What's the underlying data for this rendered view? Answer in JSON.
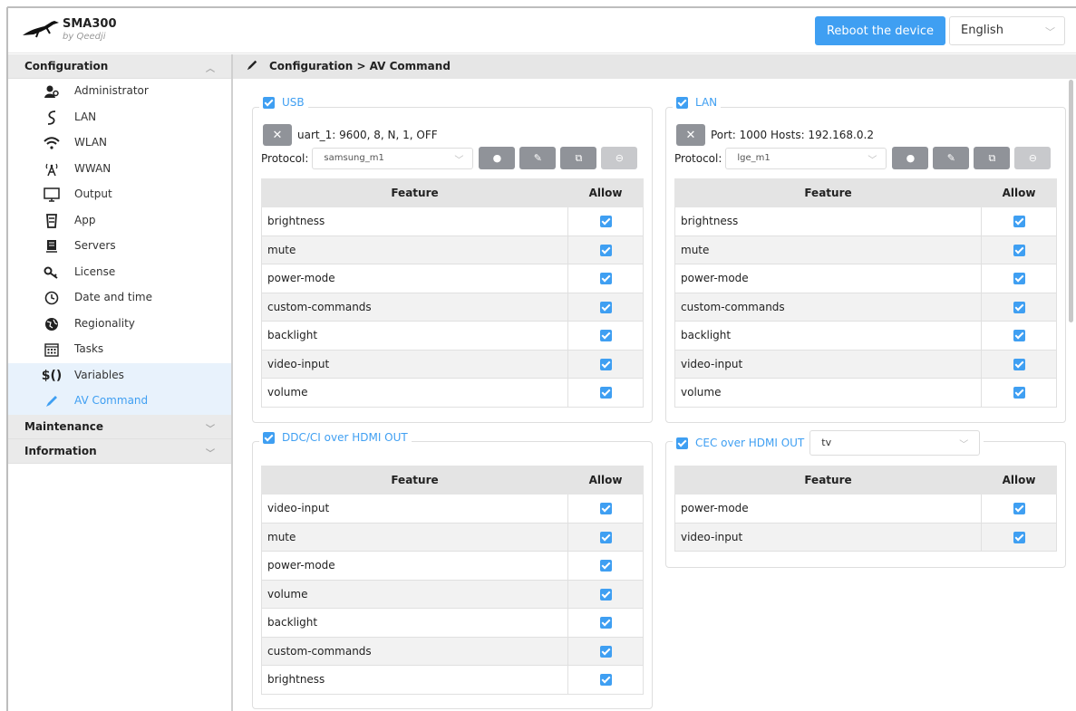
{
  "app": {
    "title": "SMA300",
    "subtitle": "by Qeedji"
  },
  "header": {
    "reboot_label": "Reboot the device",
    "language": "English"
  },
  "sidebar": {
    "configuration_label": "Configuration",
    "maintenance_label": "Maintenance",
    "information_label": "Information",
    "items": [
      {
        "label": "Administrator",
        "icon": "administrator-icon"
      },
      {
        "label": "LAN",
        "icon": "lan-icon"
      },
      {
        "label": "WLAN",
        "icon": "wifi-icon"
      },
      {
        "label": "WWAN",
        "icon": "antenna-icon"
      },
      {
        "label": "Output",
        "icon": "monitor-icon"
      },
      {
        "label": "App",
        "icon": "app-icon"
      },
      {
        "label": "Servers",
        "icon": "server-icon"
      },
      {
        "label": "License",
        "icon": "key-icon"
      },
      {
        "label": "Date and time",
        "icon": "clock-icon"
      },
      {
        "label": "Regionality",
        "icon": "globe-icon"
      },
      {
        "label": "Tasks",
        "icon": "calendar-icon"
      },
      {
        "label": "Variables",
        "icon": "variables-icon"
      },
      {
        "label": "AV Command",
        "icon": "pen-icon"
      }
    ]
  },
  "breadcrumb": "Configuration > AV Command",
  "table_headers": {
    "feature": "Feature",
    "allow": "Allow"
  },
  "usb": {
    "label": "USB",
    "connection": "uart_1: 9600, 8, N, 1, OFF",
    "protocol_label": "Protocol:",
    "protocol": "samsung_m1",
    "features": [
      "brightness",
      "mute",
      "power-mode",
      "custom-commands",
      "backlight",
      "video-input",
      "volume"
    ]
  },
  "lan": {
    "label": "LAN",
    "connection": "Port: 1000 Hosts: 192.168.0.2",
    "protocol_label": "Protocol:",
    "protocol": "lge_m1",
    "features": [
      "brightness",
      "mute",
      "power-mode",
      "custom-commands",
      "backlight",
      "video-input",
      "volume"
    ]
  },
  "ddc": {
    "label": "DDC/CI over HDMI OUT",
    "features": [
      "video-input",
      "mute",
      "power-mode",
      "volume",
      "backlight",
      "custom-commands",
      "brightness"
    ]
  },
  "cec": {
    "label": "CEC over HDMI OUT",
    "device": "tv",
    "features": [
      "power-mode",
      "video-input"
    ]
  },
  "colors": {
    "accent": "#3f9ff2",
    "button_gray": "#909399"
  }
}
